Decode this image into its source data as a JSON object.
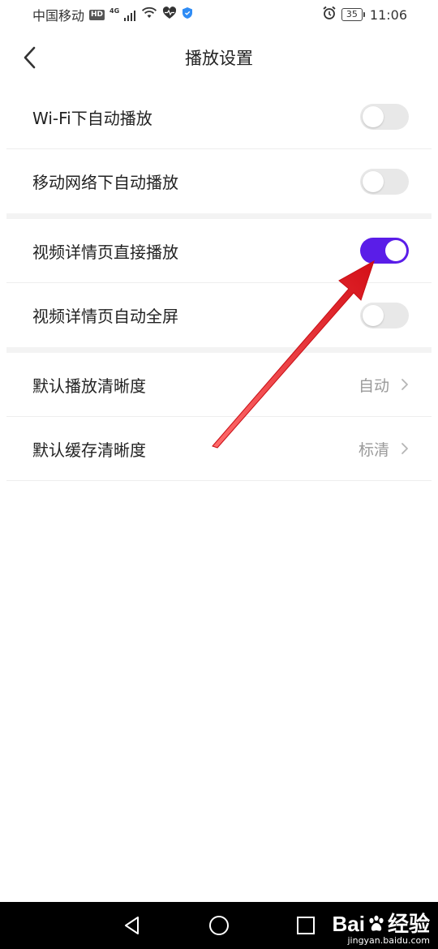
{
  "status_bar": {
    "carrier": "中国移动",
    "hd": "HD",
    "network": "4G",
    "battery": "35",
    "time": "11:06"
  },
  "header": {
    "title": "播放设置"
  },
  "settings": {
    "wifi_autoplay": {
      "label": "Wi-Fi下自动播放",
      "enabled": false
    },
    "mobile_autoplay": {
      "label": "移动网络下自动播放",
      "enabled": false
    },
    "detail_direct_play": {
      "label": "视频详情页直接播放",
      "enabled": true
    },
    "detail_auto_fullscreen": {
      "label": "视频详情页自动全屏",
      "enabled": false
    },
    "default_play_quality": {
      "label": "默认播放清晰度",
      "value": "自动"
    },
    "default_cache_quality": {
      "label": "默认缓存清晰度",
      "value": "标清"
    }
  },
  "colors": {
    "toggle_on": "#5a1de8",
    "toggle_off": "#e8e8e8",
    "annotation": "#e8141c"
  },
  "watermark": {
    "logo_left": "Bai",
    "logo_right": "经验",
    "url": "jingyan.baidu.com"
  }
}
